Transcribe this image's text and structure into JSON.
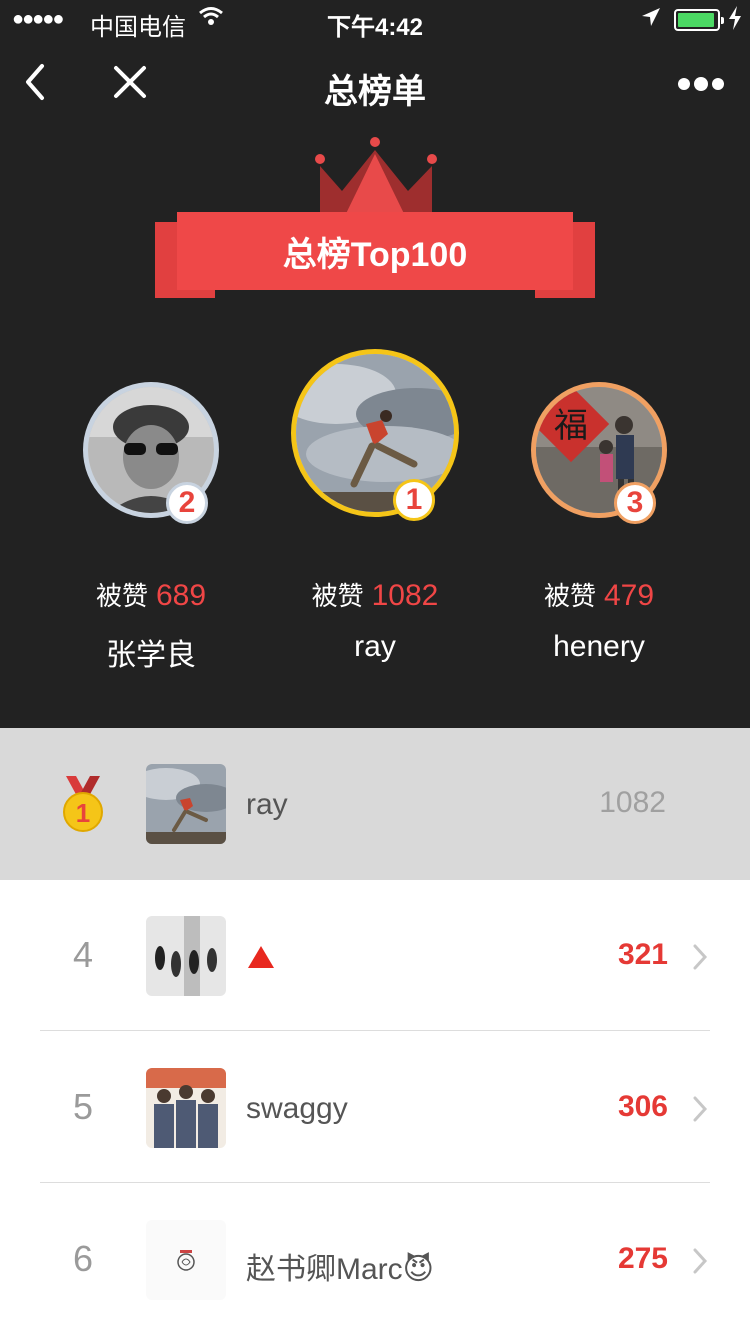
{
  "status_bar": {
    "signal": "●●●●●",
    "carrier": "中国电信",
    "time": "下午4:42"
  },
  "nav": {
    "title": "总榜单"
  },
  "banner": {
    "title": "总榜Top100"
  },
  "podium": [
    {
      "rank": "2",
      "likes_label": "被赞",
      "likes": "689",
      "name": "张学良"
    },
    {
      "rank": "1",
      "likes_label": "被赞",
      "likes": "1082",
      "name": "ray"
    },
    {
      "rank": "3",
      "likes_label": "被赞",
      "likes": "479",
      "name": "henery"
    }
  ],
  "my_row": {
    "rank": "1",
    "name": "ray",
    "score": "1082"
  },
  "rows": [
    {
      "rank": "4",
      "name": "",
      "score": "321"
    },
    {
      "rank": "5",
      "name": "swaggy",
      "score": "306"
    },
    {
      "rank": "6",
      "name": "赵书卿Marc😈",
      "score": "275"
    }
  ],
  "colors": {
    "header_bg": "#222222",
    "accent_red": "#ef4848",
    "gold": "#f5c518",
    "silver": "#c8d3e0",
    "bronze": "#f0a062"
  }
}
